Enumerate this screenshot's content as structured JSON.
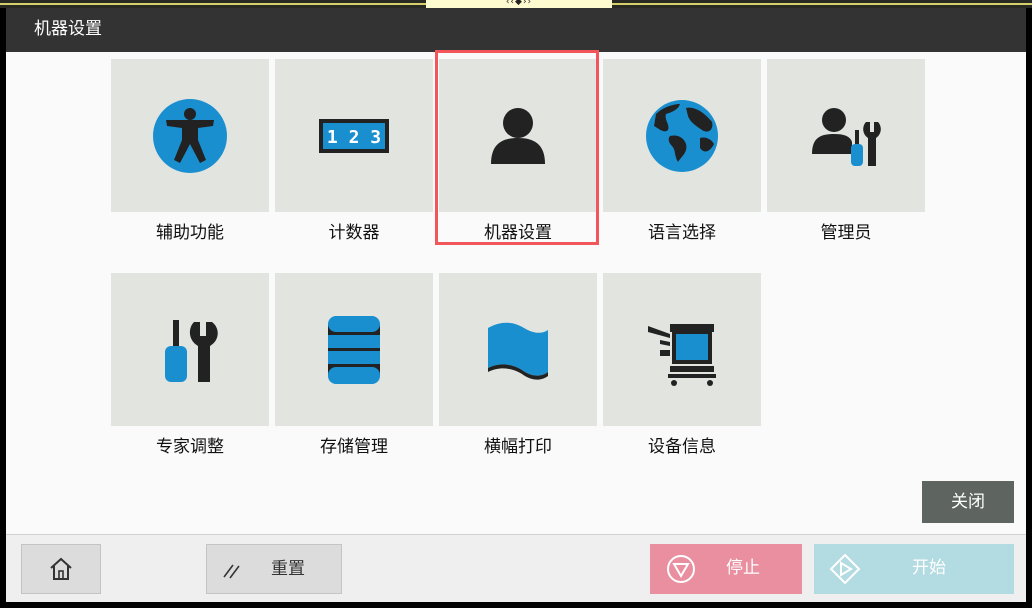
{
  "window": {
    "title": "机器设置",
    "handle_glyph": "‹‹◆››"
  },
  "tiles": [
    {
      "label": "辅助功能",
      "icon": "accessibility-icon"
    },
    {
      "label": "计数器",
      "icon": "counter-icon",
      "counter_text": "1 2 3"
    },
    {
      "label": "机器设置",
      "icon": "user-icon",
      "selected": true
    },
    {
      "label": "语言选择",
      "icon": "globe-icon"
    },
    {
      "label": "管理员",
      "icon": "admin-icon"
    },
    {
      "label": "专家调整",
      "icon": "tools-icon"
    },
    {
      "label": "存储管理",
      "icon": "database-icon"
    },
    {
      "label": "横幅打印",
      "icon": "banner-icon"
    },
    {
      "label": "设备信息",
      "icon": "device-icon"
    }
  ],
  "close_label": "关闭",
  "footer": {
    "home_icon": "home-icon",
    "reset_label": "重置",
    "stop_label": "停止",
    "start_label": "开始"
  },
  "colors": {
    "accent_blue": "#1a8fd0",
    "dark_icon": "#222222",
    "highlight": "#f0565a",
    "stop": "#e98fa0",
    "start": "#b3dbe2"
  }
}
